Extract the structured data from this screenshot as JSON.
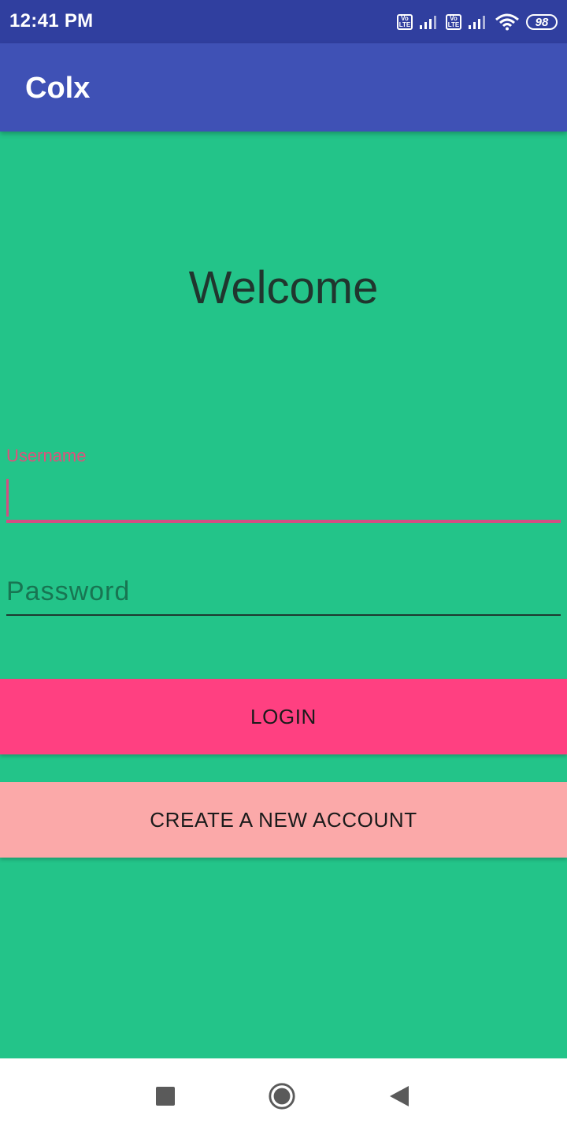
{
  "status_bar": {
    "time": "12:41 PM",
    "volte_label_top": "Vo",
    "volte_label_bottom": "LTE",
    "battery_level": "98",
    "icons": [
      "volte-icon",
      "signal-icon",
      "volte-icon",
      "signal-icon",
      "wifi-icon",
      "battery-icon"
    ]
  },
  "app_bar": {
    "title": "Colx"
  },
  "main": {
    "welcome_text": "Welcome",
    "username": {
      "label": "Username",
      "value": ""
    },
    "password": {
      "placeholder": "Password",
      "value": ""
    },
    "login_label": "LOGIN",
    "create_account_label": "CREATE A NEW ACCOUNT"
  },
  "nav_bar": {
    "icons": [
      "recents-icon",
      "home-icon",
      "back-icon"
    ]
  },
  "colors": {
    "status_bar": "#303f9f",
    "app_bar": "#3f51b5",
    "background": "#23c489",
    "accent": "#ff4081",
    "secondary_button": "#fba9a9"
  }
}
